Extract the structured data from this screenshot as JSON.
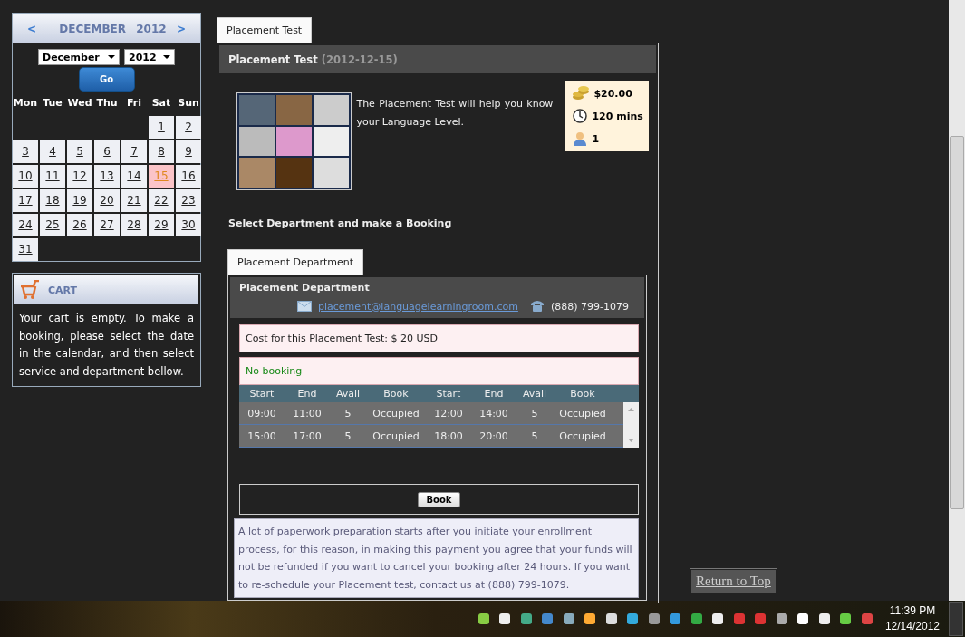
{
  "calendar": {
    "prev": "<",
    "month": "DECEMBER",
    "year": "2012",
    "next": ">",
    "month_select": "December",
    "year_select": "2012",
    "go": "Go",
    "weekdays": [
      "Mon",
      "Tue",
      "Wed",
      "Thu",
      "Fri",
      "Sat",
      "Sun"
    ],
    "weeks": [
      {
        "days": [
          {
            "kind": "blank"
          },
          {
            "kind": "blank"
          },
          {
            "kind": "blank"
          },
          {
            "kind": "blank"
          },
          {
            "kind": "blank"
          },
          {
            "kind": "day",
            "label": "1",
            "selected": false
          },
          {
            "label": "2",
            "selected": false
          }
        ]
      },
      {
        "days": [
          {
            "label": "3",
            "selected": false
          },
          {
            "label": "4",
            "selected": false
          },
          {
            "label": "5",
            "selected": false
          },
          {
            "label": "6",
            "selected": false
          },
          {
            "label": "7",
            "selected": false
          },
          {
            "label": "8",
            "selected": false
          },
          {
            "label": "9",
            "selected": false
          }
        ]
      },
      {
        "days": [
          {
            "label": "10",
            "selected": false
          },
          {
            "label": "11",
            "selected": false
          },
          {
            "label": "12",
            "selected": false
          },
          {
            "label": "13",
            "selected": false
          },
          {
            "label": "14",
            "selected": false
          },
          {
            "label": "15",
            "selected": true
          },
          {
            "label": "16",
            "selected": false
          }
        ]
      },
      {
        "days": [
          {
            "label": "17",
            "selected": false
          },
          {
            "label": "18",
            "selected": false
          },
          {
            "label": "19",
            "selected": false
          },
          {
            "label": "20",
            "selected": false
          },
          {
            "label": "21",
            "selected": false
          },
          {
            "label": "22",
            "selected": false
          },
          {
            "label": "23",
            "selected": false
          }
        ]
      },
      {
        "days": [
          {
            "label": "24",
            "selected": false
          },
          {
            "label": "25",
            "selected": false
          },
          {
            "label": "26",
            "selected": false
          },
          {
            "label": "27",
            "selected": false
          },
          {
            "label": "28",
            "selected": false
          },
          {
            "label": "29",
            "selected": false
          },
          {
            "label": "30",
            "selected": false
          }
        ]
      },
      {
        "days": [
          {
            "label": "31",
            "selected": false
          }
        ]
      }
    ]
  },
  "cart": {
    "title": "CART",
    "text": "Your cart is empty. To make a booking, please select the date in the calendar, and then select service and department bellow."
  },
  "main": {
    "tab": "Placement Test",
    "title": "Placement Test",
    "date": "(2012-12-15)",
    "description": "The Placement Test will help you know your Language Level.",
    "info": [
      {
        "kind": "price",
        "text": "$20.00"
      },
      {
        "kind": "duration",
        "text": "120 mins"
      },
      {
        "kind": "people",
        "text": "1"
      }
    ],
    "select_heading": "Select Department and make a Booking",
    "department": {
      "tab": "Placement Department",
      "title": "Placement Department",
      "email": "placement@languagelearningroom.com",
      "phone": "(888) 799-1079",
      "cost": "Cost for this Placement Test: $ 20 USD",
      "status": "No booking",
      "columns": [
        "Start",
        "End",
        "Avail",
        "Book",
        "Start",
        "End",
        "Avail",
        "Book"
      ],
      "rows": [
        [
          "09:00",
          "11:00",
          "5",
          "Occupied",
          "12:00",
          "14:00",
          "5",
          "Occupied"
        ],
        [
          "15:00",
          "17:00",
          "5",
          "Occupied",
          "18:00",
          "20:00",
          "5",
          "Occupied"
        ]
      ],
      "book": "Book",
      "note": "A lot of paperwork preparation starts after you initiate your enrollment process, for this reason, in making this payment you agree that your funds will not be refunded if you want to cancel your booking after 24 hours. If you want to re-schedule your Placement test, contact us at (888) 799-1079."
    }
  },
  "return_to_top": "Return to Top",
  "taskbar": {
    "time": "11:39 PM",
    "date": "12/14/2012"
  }
}
